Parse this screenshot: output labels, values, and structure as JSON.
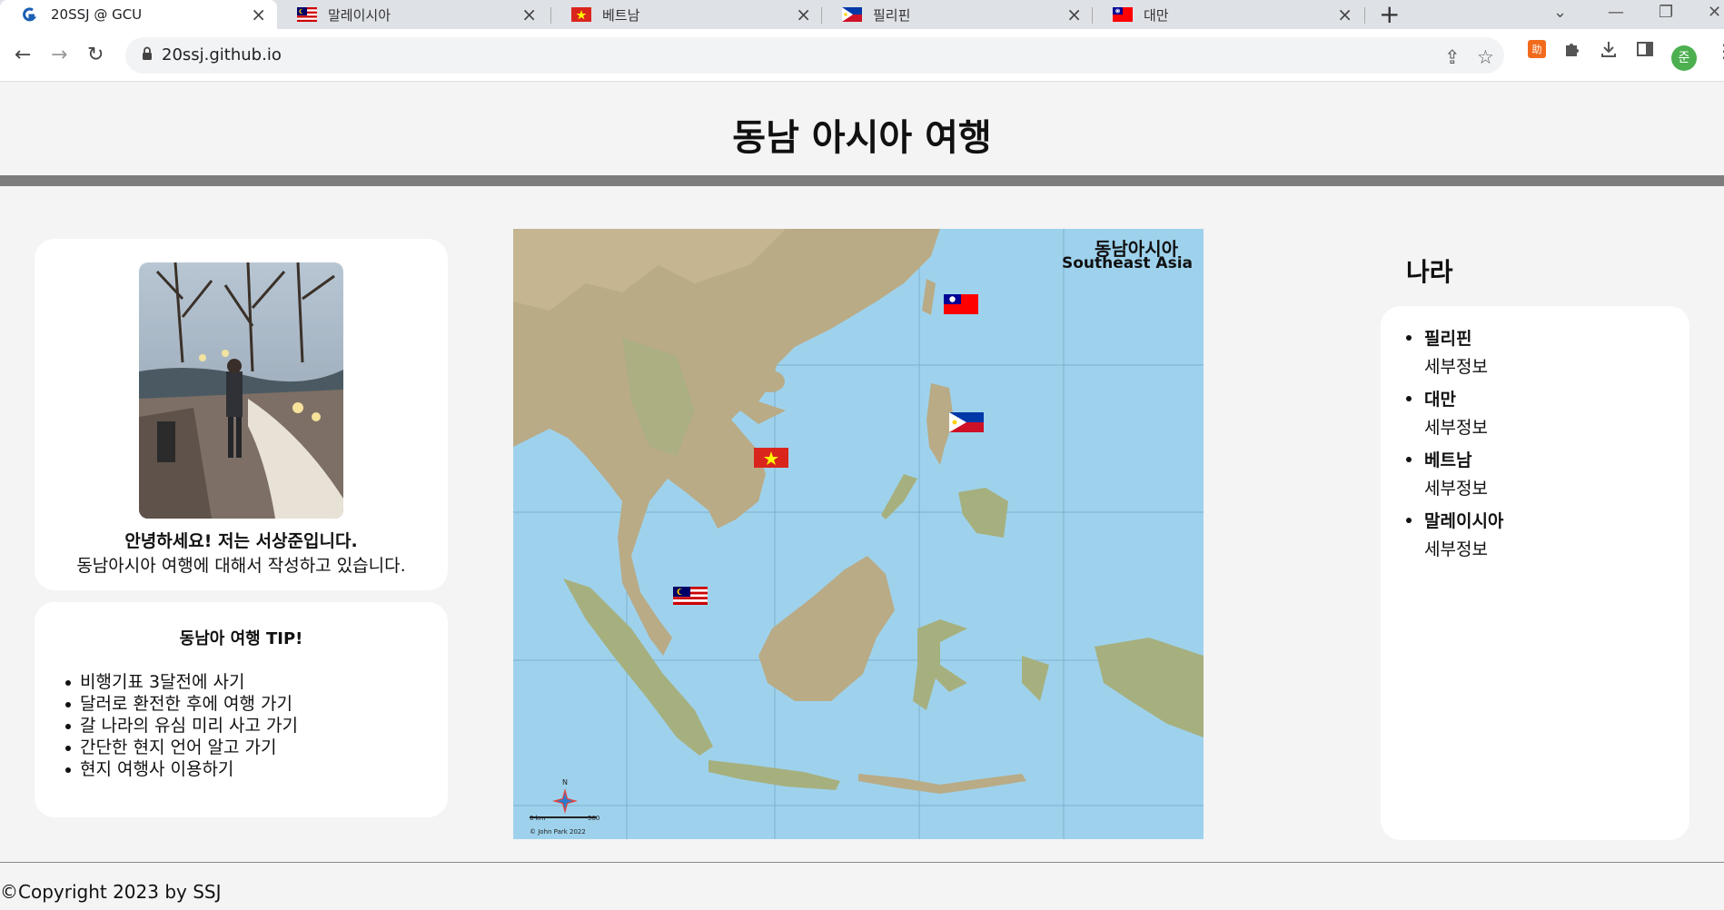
{
  "browser": {
    "tabs": [
      {
        "title": "20SSJ @ GCU",
        "active": true
      },
      {
        "title": "말레이시아",
        "active": false
      },
      {
        "title": "베트남",
        "active": false
      },
      {
        "title": "필리핀",
        "active": false
      },
      {
        "title": "대만",
        "active": false
      }
    ],
    "new_tab": "+",
    "url": "20ssj.github.io",
    "profile_initial": "준"
  },
  "header": {
    "title": "동남 아시아 여행"
  },
  "profile": {
    "greeting": "안녕하세요! 저는 서상준입니다.",
    "intro": "동남아시아 여행에 대해서 작성하고 있습니다."
  },
  "tips": {
    "title": "동남아 여행 TIP!",
    "items": [
      "비행기표 3달전에 사기",
      "달러로 환전한 후에 여행 가기",
      "갈 나라의 유심 미리 사고 가기",
      "간단한 현지 언어 알고 가기",
      "현지 여행사 이용하기"
    ]
  },
  "map": {
    "title_ko": "동남아시아",
    "title_en": "Southeast Asia",
    "credit": "© John Park 2022",
    "scale_start": "0 km",
    "scale_end": "500",
    "compass": "N"
  },
  "countries": {
    "heading": "나라",
    "items": [
      {
        "name": "필리핀",
        "detail": "세부정보"
      },
      {
        "name": "대만",
        "detail": "세부정보"
      },
      {
        "name": "베트남",
        "detail": "세부정보"
      },
      {
        "name": "말레이시아",
        "detail": "세부정보"
      }
    ]
  },
  "footer": {
    "copyright": "©Copyright 2023 by SSJ"
  }
}
